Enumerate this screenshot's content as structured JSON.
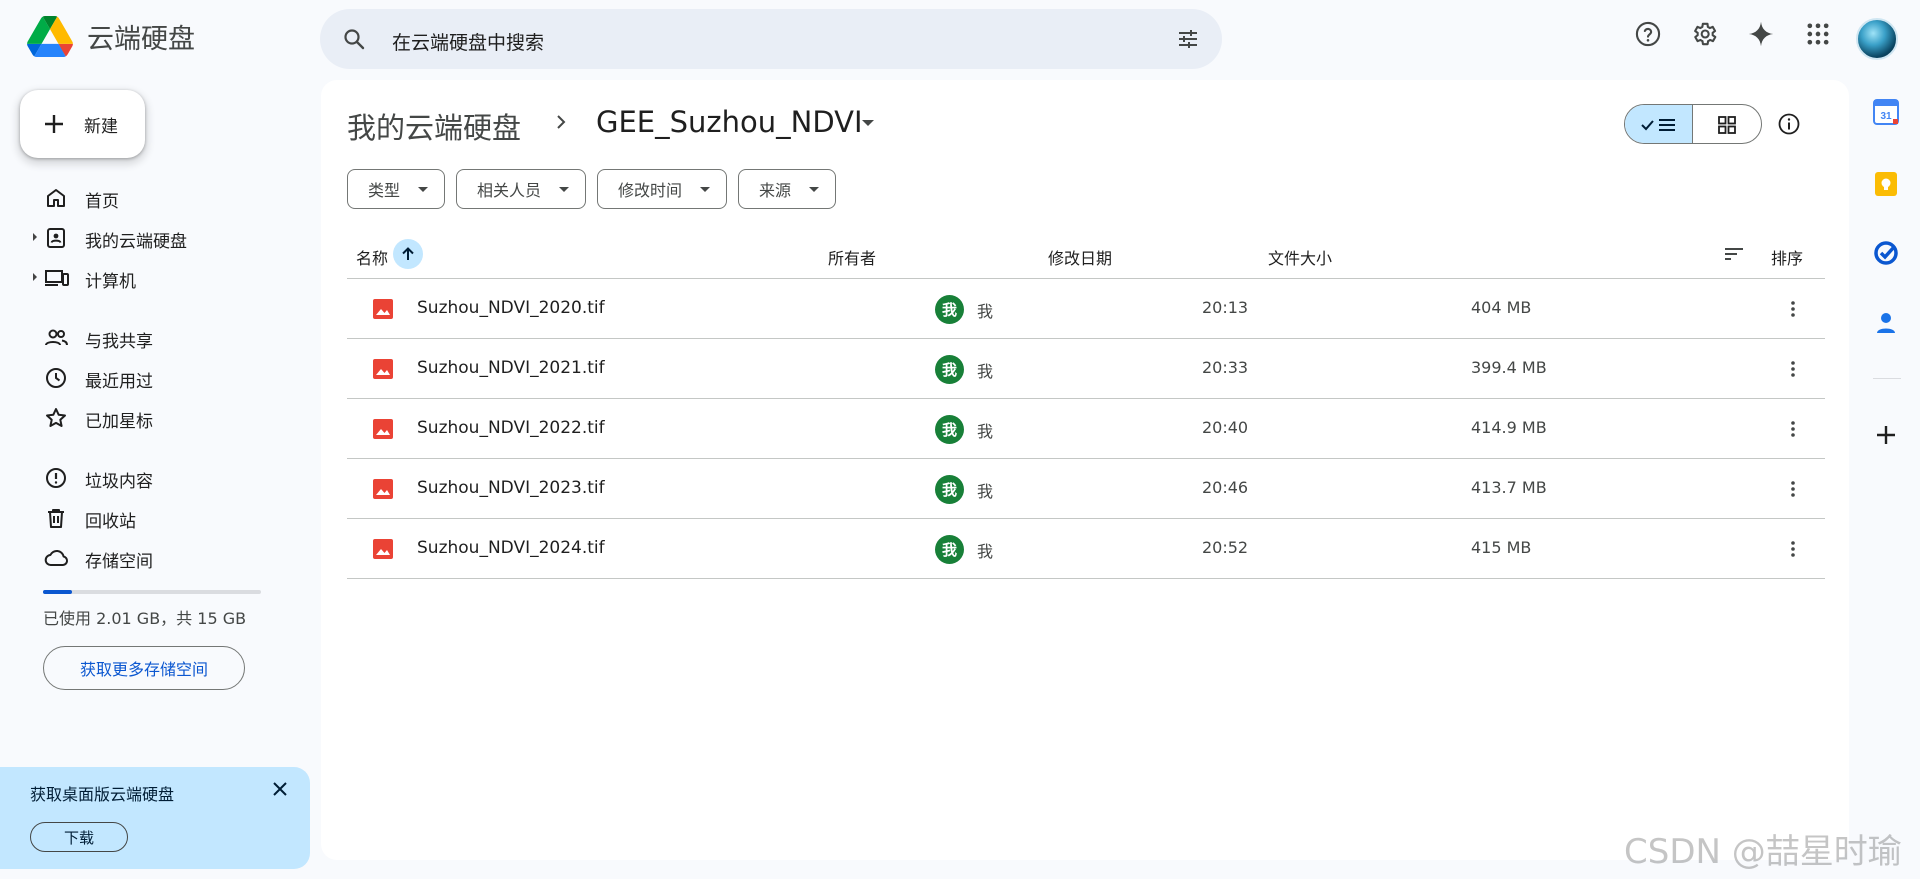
{
  "app": {
    "title": "云端硬盘"
  },
  "search": {
    "placeholder": "在云端硬盘中搜索"
  },
  "new_button": {
    "label": "新建"
  },
  "sidebar": {
    "items": [
      {
        "label": "首页",
        "icon": "home-icon"
      },
      {
        "label": "我的云端硬盘",
        "icon": "my-drive-icon"
      },
      {
        "label": "计算机",
        "icon": "computers-icon"
      },
      {
        "label": "与我共享",
        "icon": "shared-icon"
      },
      {
        "label": "最近用过",
        "icon": "recent-icon"
      },
      {
        "label": "已加星标",
        "icon": "star-icon"
      },
      {
        "label": "垃圾内容",
        "icon": "spam-icon"
      },
      {
        "label": "回收站",
        "icon": "trash-icon"
      },
      {
        "label": "存储空间",
        "icon": "cloud-icon"
      }
    ],
    "storage_text": "已使用 2.01 GB，共 15 GB",
    "storage_used_fraction": 0.134,
    "get_more_storage": "获取更多存储空间"
  },
  "promo": {
    "title": "获取桌面版云端硬盘",
    "download": "下载"
  },
  "breadcrumb": {
    "root": "我的云端硬盘",
    "current": "GEE_Suzhou_NDVI"
  },
  "filters": [
    "类型",
    "相关人员",
    "修改时间",
    "来源"
  ],
  "table": {
    "headers": {
      "name": "名称",
      "owner": "所有者",
      "modified": "修改日期",
      "size": "文件大小",
      "sort": "排序"
    },
    "rows": [
      {
        "name": "Suzhou_NDVI_2020.tif",
        "owner_badge": "我",
        "owner": "我",
        "modified": "20:13",
        "size": "404 MB"
      },
      {
        "name": "Suzhou_NDVI_2021.tif",
        "owner_badge": "我",
        "owner": "我",
        "modified": "20:33",
        "size": "399.4 MB"
      },
      {
        "name": "Suzhou_NDVI_2022.tif",
        "owner_badge": "我",
        "owner": "我",
        "modified": "20:40",
        "size": "414.9 MB"
      },
      {
        "name": "Suzhou_NDVI_2023.tif",
        "owner_badge": "我",
        "owner": "我",
        "modified": "20:46",
        "size": "413.7 MB"
      },
      {
        "name": "Suzhou_NDVI_2024.tif",
        "owner_badge": "我",
        "owner": "我",
        "modified": "20:52",
        "size": "415 MB"
      }
    ]
  },
  "rail": {
    "calendar_day": "31"
  },
  "watermark": "CSDN @喆星时瑜",
  "colors": {
    "accent": "#0b57d0",
    "selected": "#c2e7ff",
    "owner_badge": "#188038",
    "image_file": "#ea4335"
  }
}
